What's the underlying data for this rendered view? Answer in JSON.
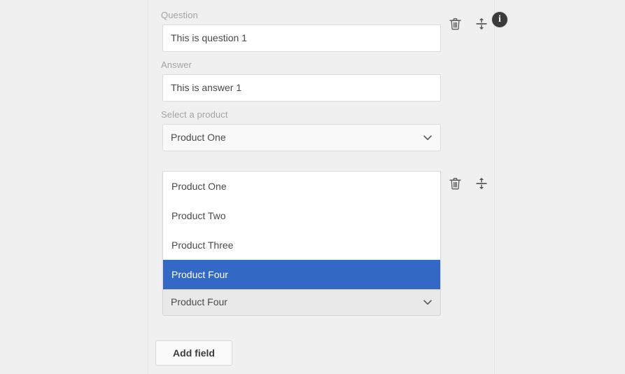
{
  "theme": {
    "page_background": "#f0f0f0",
    "input_background": "#ffffff",
    "select_background": "#f9f9f9",
    "select_active_background": "#e9e9e9",
    "border": "#dcdcdc",
    "label_color": "#a3a3a3",
    "text_color": "#4a4a4a",
    "highlight_background": "#3368c4",
    "highlight_text": "#ffffff",
    "info_badge_background": "#3b3b3b"
  },
  "fields": [
    {
      "label": "Question",
      "value": "This is question 1",
      "type": "text"
    },
    {
      "label": "Answer",
      "value": "This is answer 1",
      "type": "text"
    },
    {
      "label": "Select a product",
      "value": "Product One",
      "type": "select",
      "state": "closed"
    }
  ],
  "second_row": {
    "select": {
      "value": "Product Four",
      "state": "open"
    },
    "options": [
      {
        "label": "Product One",
        "selected": false
      },
      {
        "label": "Product Two",
        "selected": false
      },
      {
        "label": "Product Three",
        "selected": false
      },
      {
        "label": "Product Four",
        "selected": true
      }
    ]
  },
  "icons": {
    "delete": "trash-icon",
    "reorder": "vertical-resize-handle-icon",
    "info": "info-icon",
    "info_glyph": "i",
    "chevron": "chevron-down-icon"
  },
  "buttons": {
    "add_field": "Add field"
  }
}
